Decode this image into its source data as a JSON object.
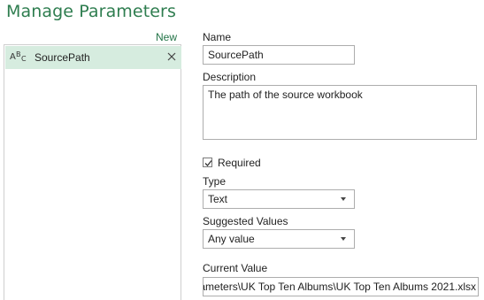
{
  "dialog": {
    "title": "Manage Parameters"
  },
  "list": {
    "new_label": "New",
    "items": [
      {
        "label": "SourcePath",
        "icon": "abc-text-type-icon",
        "icon_glyphs": [
          "A",
          "B",
          "C"
        ]
      }
    ]
  },
  "form": {
    "name_label": "Name",
    "name_value": "SourcePath",
    "description_label": "Description",
    "description_value": "The path of the source workbook",
    "required_label": "Required",
    "required_checked": true,
    "type_label": "Type",
    "type_value": "Text",
    "suggested_label": "Suggested Values",
    "suggested_value": "Any value",
    "current_label": "Current Value",
    "current_value": "ameters\\UK Top Ten Albums\\UK Top Ten Albums 2021.xlsx"
  },
  "colors": {
    "title": "#2e7d4f",
    "accent": "#217346",
    "selected_bg": "#d6ecdf"
  }
}
